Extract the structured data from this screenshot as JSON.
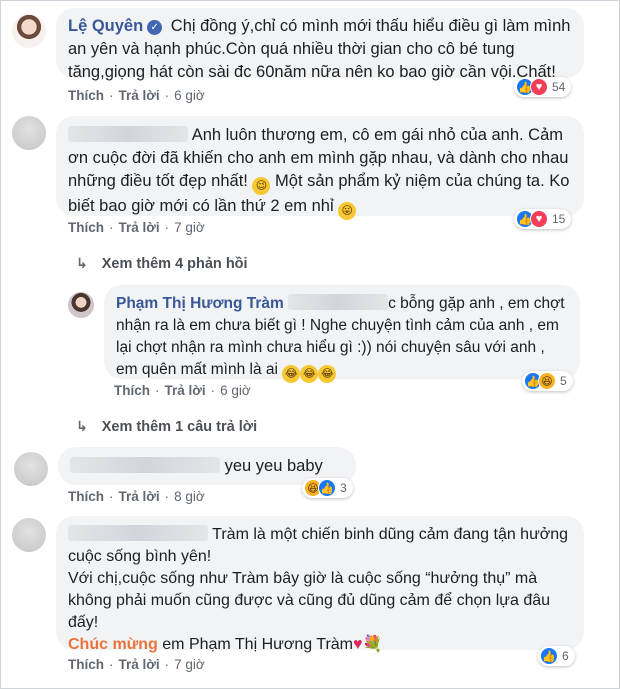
{
  "comments": [
    {
      "name": "Lệ Quyên",
      "text": "Chị đồng ý,chỉ có mình mới thấu hiểu điều gì làm mình an yên và hạnh phúc.Còn quá nhiều thời gian cho cô bé tung tăng,giọng hát còn sài đc 60năm nữa nên ko bao giờ cần vội.Chất!",
      "like": "Thích",
      "reply": "Trả lời",
      "time": "6 giờ",
      "reaction_count": "54"
    },
    {
      "text": "Anh luôn thương em, cô em gái nhỏ của anh. Cảm ơn cuộc đời đã khiến cho anh em mình gặp nhau, và dành cho nhau những điều tốt đẹp nhất!",
      "text2": "Một sản phẩm kỷ niệm của chúng ta. Ko biết bao giờ mới có lần thứ 2 em nhỉ",
      "like": "Thích",
      "reply": "Trả lời",
      "time": "7 giờ",
      "reaction_count": "15",
      "more_replies": "Xem thêm 4 phản hồi"
    },
    {
      "name": "Phạm Thị Hương Tràm",
      "text": "c bỗng gặp anh , em chợt nhận ra là em chưa biết gì ! Nghe chuyện tình cảm của anh , em lại chợt nhận ra mình chưa hiểu gì :)) nói chuyện sâu với anh , em quên mất mình là ai",
      "like": "Thích",
      "reply": "Trả lời",
      "time": "6 giờ",
      "reaction_count": "5",
      "more_replies": "Xem thêm 1 câu trả lời"
    },
    {
      "text": "yeu yeu baby",
      "like": "Thích",
      "reply": "Trả lời",
      "time": "8 giờ",
      "reaction_count": "3"
    },
    {
      "text": "Tràm là một chiến binh dũng cảm đang tận hưởng cuộc sống bình yên!",
      "text2": "Với chị,cuộc sống như Tràm bây giờ là cuộc sống “hưởng thụ” mà không phải muốn cũng được và cũng đủ dũng cảm để chọn lựa đâu đấy!",
      "congrats": "Chúc mừng",
      "congrats_rest": "em Phạm Thị Hương Tràm",
      "like": "Thích",
      "reply": "Trả lời",
      "time": "7 giờ",
      "reaction_count": "6"
    }
  ],
  "icons": {
    "like": "like-reaction-icon",
    "love": "love-reaction-icon",
    "haha": "haha-reaction-icon",
    "verified": "verified-badge-icon",
    "reply_arrow": "reply-arrow-icon"
  },
  "colors": {
    "name": "#385898",
    "bubble": "#f2f3f5",
    "like": "#1877f2",
    "love": "#f33e58",
    "haha": "#f7b125",
    "congrats": "#e8743b"
  }
}
